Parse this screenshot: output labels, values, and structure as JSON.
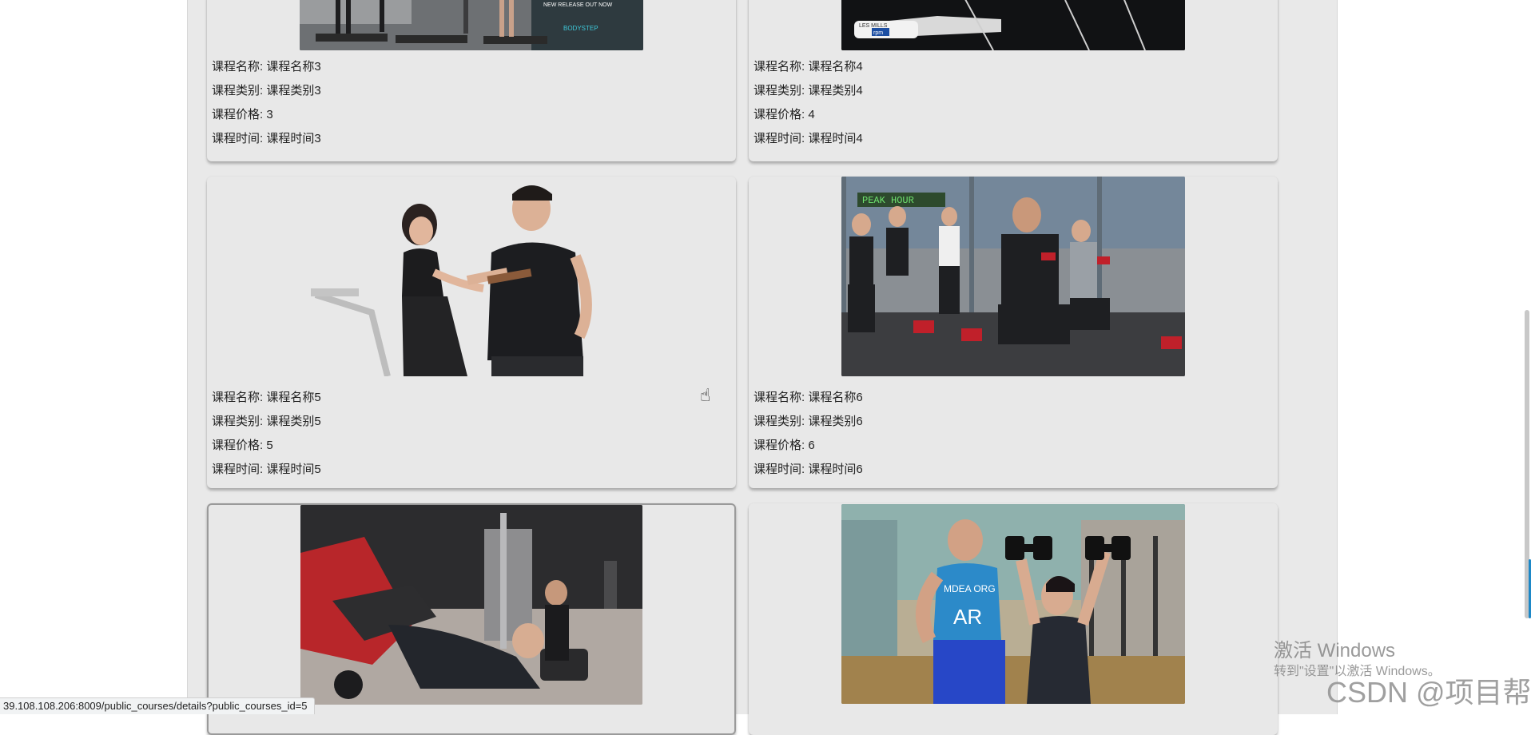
{
  "labels": {
    "name": "课程名称: ",
    "type": "课程类别: ",
    "price": "课程价格: ",
    "time": "课程时间: "
  },
  "courses": [
    {
      "name": "课程名称3",
      "type": "课程类别3",
      "price": "3",
      "time": "课程时间3",
      "image": "step-aerobics-photo"
    },
    {
      "name": "课程名称4",
      "type": "课程类别4",
      "price": "4",
      "time": "课程时间4",
      "image": "spin-bike-photo"
    },
    {
      "name": "课程名称5",
      "type": "课程类别5",
      "price": "5",
      "time": "课程时间5",
      "image": "coach-and-cyclist-photo"
    },
    {
      "name": "课程名称6",
      "type": "课程类别6",
      "price": "6",
      "time": "课程时间6",
      "image": "kettlebell-lunge-class-photo"
    },
    {
      "image": "leg-press-training-photo"
    },
    {
      "image": "dumbbell-press-photo"
    }
  ],
  "status_bar": {
    "url": "39.108.108.206:8009/public_courses/details?public_courses_id=5"
  },
  "watermark": {
    "title": "激活 Windows",
    "subtitle": "转到\"设置\"以激活 Windows。",
    "csdn": "CSDN @项目帮"
  }
}
